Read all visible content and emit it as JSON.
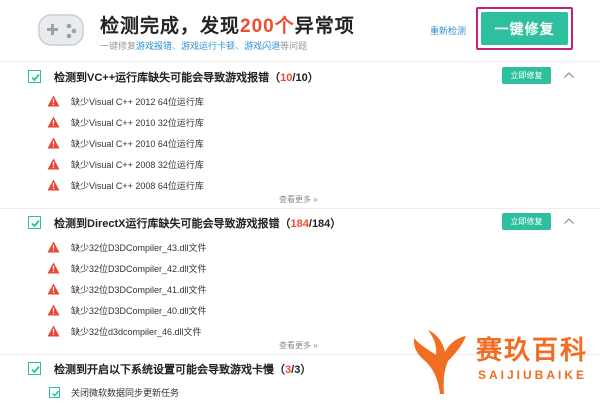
{
  "header": {
    "title_prefix": "检测完成，发现",
    "title_count": "200个",
    "title_suffix": "异常项",
    "subtitle_prefix": "一键修复",
    "subtitle_link1": "游戏报错",
    "subtitle_sep1": "、",
    "subtitle_link2": "游戏运行卡顿",
    "subtitle_sep2": "、",
    "subtitle_link3": "游戏闪退",
    "subtitle_suffix": "等问题",
    "rescan_label": "重新检测",
    "fix_all_label": "一键修复"
  },
  "sections": [
    {
      "title": "检测到VC++运行库缺失可能会导致游戏报错",
      "count_found": "10",
      "count_total": "10",
      "repair_label": "立即修复",
      "items": [
        "缺少Visual C++ 2012 64位运行库",
        "缺少Visual C++ 2010 32位运行库",
        "缺少Visual C++ 2010 64位运行库",
        "缺少Visual C++ 2008 32位运行库",
        "缺少Visual C++ 2008 64位运行库"
      ],
      "more_label": "查看更多"
    },
    {
      "title": "检测到DirectX运行库缺失可能会导致游戏报错",
      "count_found": "184",
      "count_total": "184",
      "repair_label": "立即修复",
      "items": [
        "缺少32位D3DCompiler_43.dll文件",
        "缺少32位D3DCompiler_42.dll文件",
        "缺少32位D3DCompiler_41.dll文件",
        "缺少32位D3DCompiler_40.dll文件",
        "缺少32位d3dcompiler_46.dll文件"
      ],
      "more_label": "查看更多"
    },
    {
      "title": "检测到开启以下系统设置可能会导致游戏卡慢",
      "count_found": "3",
      "count_total": "3",
      "items": [
        "关闭微软数据同步更新任务"
      ]
    }
  ],
  "watermark": {
    "brand": "赛玖百科",
    "brand_pinyin": "SAIJIUBAIKE"
  },
  "colors": {
    "accent": "#2ec09e",
    "warning": "#e8473a",
    "count_highlight": "#f04b2f",
    "link": "#2b8fd8",
    "focus_border": "#c0237e",
    "watermark": "#f26c21"
  },
  "icons": {
    "app": "gamepad-icon",
    "item_status": "warning-triangle-icon",
    "section_toggle": "chevron-up-icon",
    "more": "double-chevron-down-icon",
    "checkbox": "checkmark-icon"
  }
}
